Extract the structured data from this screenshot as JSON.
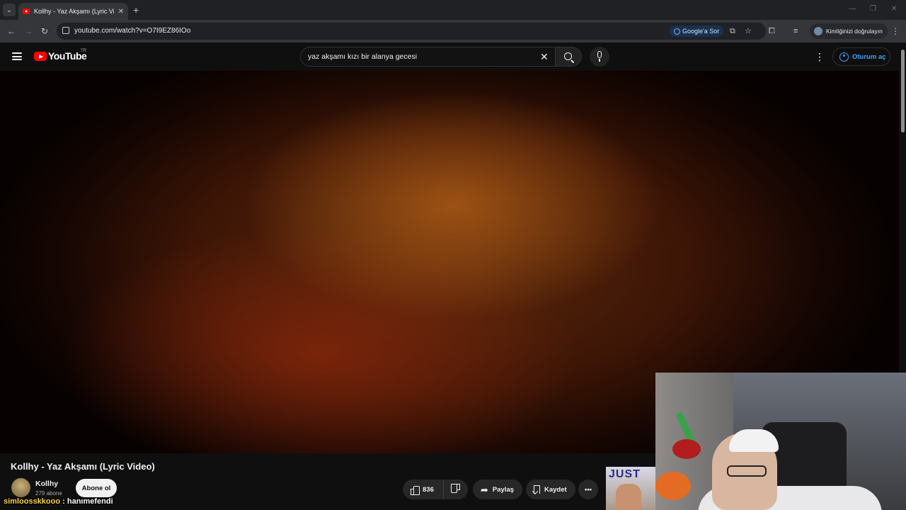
{
  "browser": {
    "tab_title": "Kollhy - Yaz Akşamı (Lyric Video)",
    "url": "youtube.com/watch?v=O7I9EZ86IOo",
    "google_sor_label": "Google'a Sor",
    "profile_label": "Kimliğinizi doğrulayın"
  },
  "masthead": {
    "logo_text": "YouTube",
    "country_code": "TR",
    "search_value": "yaz akşamı kızı bir alanya gecesi",
    "signin_label": "Oturum aç"
  },
  "video": {
    "title": "Kollhy - Yaz Akşamı (Lyric Video)",
    "channel_name": "Kollhy",
    "subscriber_count": "279 abone",
    "subscribe_label": "Abone ol",
    "like_count": "836",
    "share_label": "Paylaş",
    "save_label": "Kaydet"
  },
  "overlay": {
    "thumbnail_text": "JUST",
    "chat_user": "simloosskkooo",
    "chat_separator": ":",
    "chat_message": "hanımefendi"
  },
  "colors": {
    "youtube_red": "#ff0000",
    "link_blue": "#3ea6ff",
    "chat_user": "#ffd54a"
  }
}
